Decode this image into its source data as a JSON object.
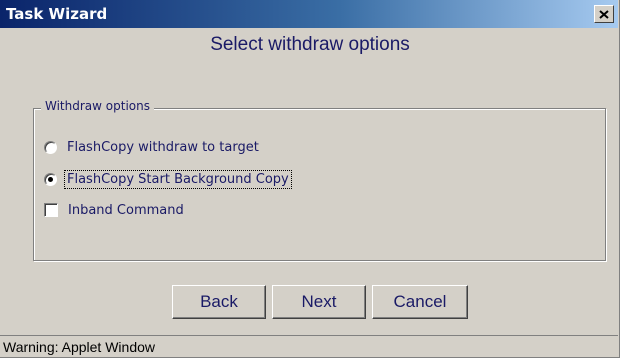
{
  "window": {
    "title": "Task Wizard"
  },
  "heading": "Select withdraw options",
  "group": {
    "legend": "Withdraw options",
    "options": [
      {
        "type": "radio",
        "label": "FlashCopy withdraw to target",
        "selected": false
      },
      {
        "type": "radio",
        "label": "FlashCopy Start Background Copy",
        "selected": true,
        "focused": true
      },
      {
        "type": "checkbox",
        "label": "Inband Command",
        "checked": false
      }
    ]
  },
  "buttons": {
    "back": "Back",
    "next": "Next",
    "cancel": "Cancel"
  },
  "status": "Warning: Applet Window",
  "icons": {
    "close": "close-icon"
  },
  "colors": {
    "title_start": "#0a246a",
    "title_end": "#a6caf0",
    "face": "#d4d0c8",
    "text": "#1a1a66"
  }
}
